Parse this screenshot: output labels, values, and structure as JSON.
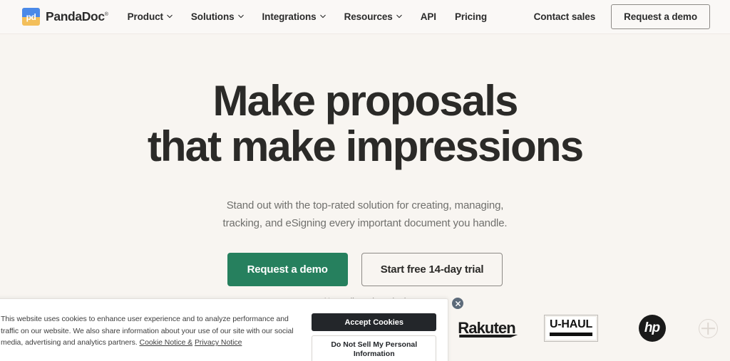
{
  "header": {
    "brand": {
      "mark_text": "pd",
      "name": "PandaDoc",
      "registered": "®"
    },
    "nav_items": [
      {
        "label": "Product",
        "has_caret": true,
        "icon": "chevron-down-icon"
      },
      {
        "label": "Solutions",
        "has_caret": true,
        "icon": "chevron-down-icon"
      },
      {
        "label": "Integrations",
        "has_caret": true,
        "icon": "chevron-down-icon"
      },
      {
        "label": "Resources",
        "has_caret": true,
        "icon": "chevron-down-icon"
      },
      {
        "label": "API",
        "has_caret": false
      },
      {
        "label": "Pricing",
        "has_caret": false
      }
    ],
    "contact_sales_label": "Contact sales",
    "request_demo_label": "Request a demo"
  },
  "hero": {
    "title_line1": "Make proposals",
    "title_line2": "that make impressions",
    "sub_line1": "Stand out with the top-rated solution for creating, managing,",
    "sub_line2": "tracking, and eSigning every important document you handle.",
    "primary_cta": "Request a demo",
    "secondary_cta": "Start free 14-day trial",
    "disclaimer": "No credit card required"
  },
  "logo_strip": {
    "close_icon": "close-circle-icon",
    "logos": [
      {
        "name": "Rakuten",
        "type": "wordmark"
      },
      {
        "name": "U-HAUL",
        "type": "boxed-wordmark"
      },
      {
        "name": "hp",
        "type": "circle-mark"
      },
      {
        "name": "",
        "type": "placeholder"
      }
    ]
  },
  "cookie_banner": {
    "body_part1": "This website uses cookies to enhance user experience and to analyze performance and traffic on our website. We also share information about your use of our site with our social media, advertising and analytics partners. ",
    "link_cookie": "Cookie Notice &",
    "link_privacy": "Privacy Notice",
    "accept_label": "Accept Cookies",
    "do_not_sell_label": "Do Not Sell My Personal Information"
  },
  "colors": {
    "page_background": "#f8f5f1",
    "header_background": "#faf8f6",
    "text_dark": "#2b2a28",
    "text_muted": "#70706d",
    "primary_green": "#26805e",
    "accent_blue": "#4a89e8",
    "accent_yellow": "#f3bf5a",
    "banner_dark": "#23262a"
  }
}
